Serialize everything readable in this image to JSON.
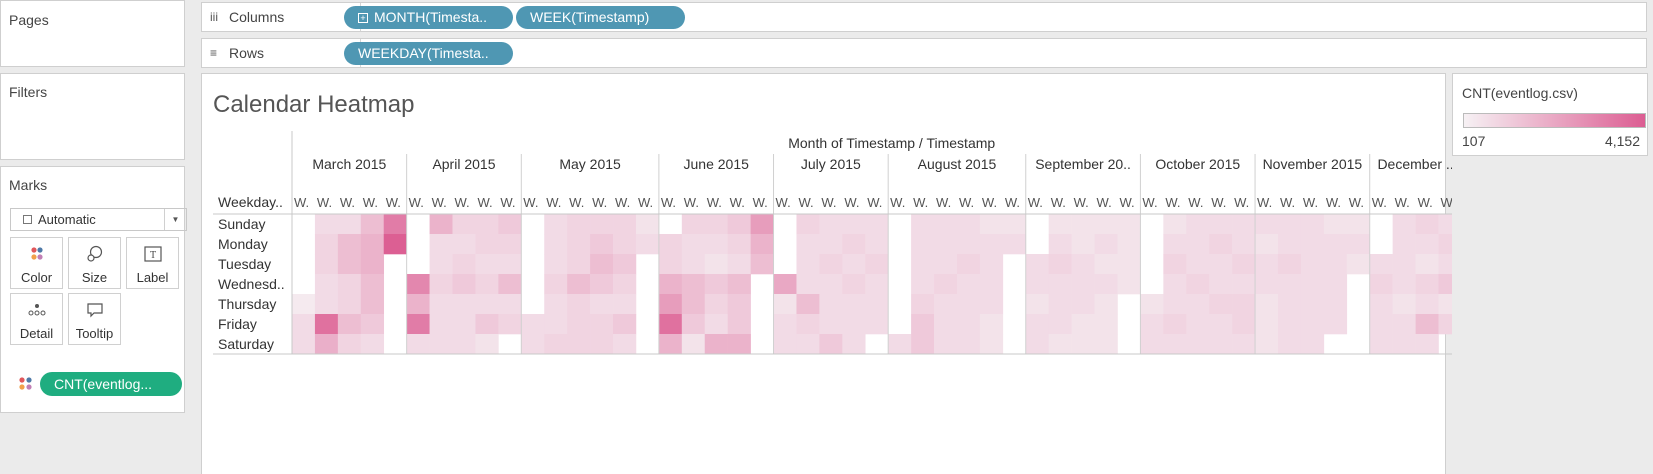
{
  "pages": {
    "title": "Pages"
  },
  "filters": {
    "title": "Filters"
  },
  "shelves": {
    "columns": {
      "label": "Columns",
      "icon": "iii",
      "pills": [
        "MONTH(Timesta..",
        "WEEK(Timestamp)"
      ]
    },
    "rows": {
      "label": "Rows",
      "icon": "≡",
      "pills": [
        "WEEKDAY(Timesta.."
      ]
    }
  },
  "marks": {
    "title": "Marks",
    "type": "Automatic",
    "buttons": [
      {
        "name": "color-button",
        "label": "Color",
        "icon": "color-dots-icon"
      },
      {
        "name": "size-button",
        "label": "Size",
        "icon": "size-circles-icon"
      },
      {
        "name": "label-button",
        "label": "Label",
        "icon": "label-t-icon"
      },
      {
        "name": "detail-button",
        "label": "Detail",
        "icon": "detail-dots-icon"
      },
      {
        "name": "tooltip-button",
        "label": "Tooltip",
        "icon": "tooltip-bubble-icon"
      }
    ],
    "field_pill": "CNT(eventlog..."
  },
  "legend": {
    "title": "CNT(eventlog.csv)",
    "min": "107",
    "max": "4,152",
    "color_low": "#f6f1f4",
    "color_high": "#dc5d92"
  },
  "viz": {
    "title": "Calendar Heatmap",
    "header": "Month of Timestamp / Timestamp",
    "row_header": "Weekday..",
    "week_label": "W.",
    "weekdays": [
      "Sunday",
      "Monday",
      "Tuesday",
      "Wednesd..",
      "Thursday",
      "Friday",
      "Saturday"
    ]
  },
  "chart_data": {
    "type": "heatmap",
    "title": "Calendar Heatmap",
    "xlabel": "Month of Timestamp / Timestamp",
    "ylabel": "Weekday..",
    "color_scale": {
      "min": 107,
      "max": 4152,
      "low": "#f6f1f4",
      "high": "#dc5d92"
    },
    "months": [
      {
        "label": "March 2015",
        "weeks": 5,
        "values": [
          [
            null,
            700,
            700,
            1500,
            3300
          ],
          [
            null,
            900,
            1500,
            1800,
            4100
          ],
          [
            null,
            900,
            1500,
            1800,
            null
          ],
          [
            null,
            700,
            900,
            1500,
            null
          ],
          [
            300,
            700,
            900,
            1500,
            null
          ],
          [
            700,
            3600,
            1500,
            1200,
            null
          ],
          [
            700,
            1900,
            900,
            700,
            null
          ]
        ]
      },
      {
        "label": "April 2015",
        "weeks": 5,
        "values": [
          [
            null,
            1800,
            900,
            900,
            1200
          ],
          [
            null,
            700,
            700,
            900,
            900
          ],
          [
            null,
            700,
            900,
            700,
            700
          ],
          [
            3000,
            900,
            1200,
            900,
            1500
          ],
          [
            1800,
            700,
            700,
            700,
            700
          ],
          [
            3300,
            700,
            700,
            1200,
            900
          ],
          [
            700,
            700,
            700,
            500,
            null
          ]
        ]
      },
      {
        "label": "May 2015",
        "weeks": 6,
        "values": [
          [
            null,
            700,
            900,
            900,
            900,
            500
          ],
          [
            null,
            700,
            900,
            1200,
            900,
            700
          ],
          [
            null,
            700,
            900,
            1500,
            1200,
            null
          ],
          [
            null,
            900,
            1500,
            1200,
            900,
            null
          ],
          [
            null,
            700,
            900,
            700,
            700,
            null
          ],
          [
            700,
            700,
            900,
            900,
            1200,
            null
          ],
          [
            700,
            900,
            900,
            900,
            700,
            null
          ]
        ]
      },
      {
        "label": "June 2015",
        "weeks": 5,
        "values": [
          [
            null,
            900,
            900,
            1200,
            2400
          ],
          [
            900,
            700,
            700,
            900,
            1800
          ],
          [
            900,
            700,
            500,
            700,
            1500
          ],
          [
            1800,
            1500,
            1200,
            1500,
            null
          ],
          [
            2400,
            1500,
            900,
            1200,
            null
          ],
          [
            3600,
            1200,
            700,
            1200,
            null
          ],
          [
            1800,
            500,
            1800,
            1800,
            null
          ]
        ]
      },
      {
        "label": "July 2015",
        "weeks": 5,
        "values": [
          [
            null,
            900,
            700,
            700,
            700
          ],
          [
            null,
            700,
            700,
            900,
            700
          ],
          [
            null,
            700,
            900,
            700,
            900
          ],
          [
            2100,
            700,
            700,
            900,
            700
          ],
          [
            500,
            1500,
            700,
            700,
            700
          ],
          [
            700,
            900,
            700,
            700,
            700
          ],
          [
            700,
            700,
            1200,
            700,
            null
          ]
        ]
      },
      {
        "label": "August 2015",
        "weeks": 6,
        "values": [
          [
            null,
            700,
            700,
            700,
            500,
            500
          ],
          [
            null,
            700,
            700,
            700,
            700,
            700
          ],
          [
            null,
            700,
            700,
            900,
            700,
            null
          ],
          [
            null,
            700,
            900,
            700,
            700,
            null
          ],
          [
            null,
            900,
            700,
            700,
            700,
            null
          ],
          [
            null,
            1200,
            700,
            700,
            500,
            null
          ],
          [
            700,
            1200,
            700,
            700,
            500,
            null
          ]
        ]
      },
      {
        "label": "September 20..",
        "weeks": 5,
        "values": [
          [
            null,
            500,
            500,
            500,
            500
          ],
          [
            null,
            700,
            500,
            700,
            500
          ],
          [
            700,
            900,
            700,
            500,
            500
          ],
          [
            700,
            700,
            700,
            700,
            500
          ],
          [
            500,
            700,
            700,
            500,
            null
          ],
          [
            700,
            700,
            500,
            500,
            null
          ],
          [
            700,
            500,
            500,
            500,
            null
          ]
        ]
      },
      {
        "label": "October 2015",
        "weeks": 5,
        "values": [
          [
            null,
            500,
            700,
            700,
            700
          ],
          [
            null,
            700,
            700,
            900,
            700
          ],
          [
            null,
            900,
            700,
            700,
            900
          ],
          [
            null,
            700,
            900,
            700,
            700
          ],
          [
            500,
            700,
            700,
            900,
            900
          ],
          [
            700,
            900,
            700,
            700,
            900
          ],
          [
            700,
            700,
            700,
            700,
            700
          ]
        ]
      },
      {
        "label": "November 2015",
        "weeks": 5,
        "values": [
          [
            700,
            700,
            700,
            500,
            500
          ],
          [
            500,
            700,
            700,
            700,
            700
          ],
          [
            700,
            900,
            700,
            700,
            500
          ],
          [
            700,
            700,
            700,
            700,
            null
          ],
          [
            500,
            700,
            700,
            700,
            null
          ],
          [
            500,
            700,
            700,
            700,
            null
          ],
          [
            500,
            700,
            700,
            null,
            null
          ]
        ]
      },
      {
        "label": "December ..",
        "weeks": 4,
        "values": [
          [
            null,
            700,
            900,
            700
          ],
          [
            null,
            700,
            700,
            900
          ],
          [
            700,
            700,
            500,
            700
          ],
          [
            900,
            700,
            900,
            1200
          ],
          [
            700,
            500,
            700,
            500
          ],
          [
            700,
            700,
            1500,
            900
          ],
          [
            700,
            700,
            700,
            null
          ]
        ]
      }
    ]
  }
}
